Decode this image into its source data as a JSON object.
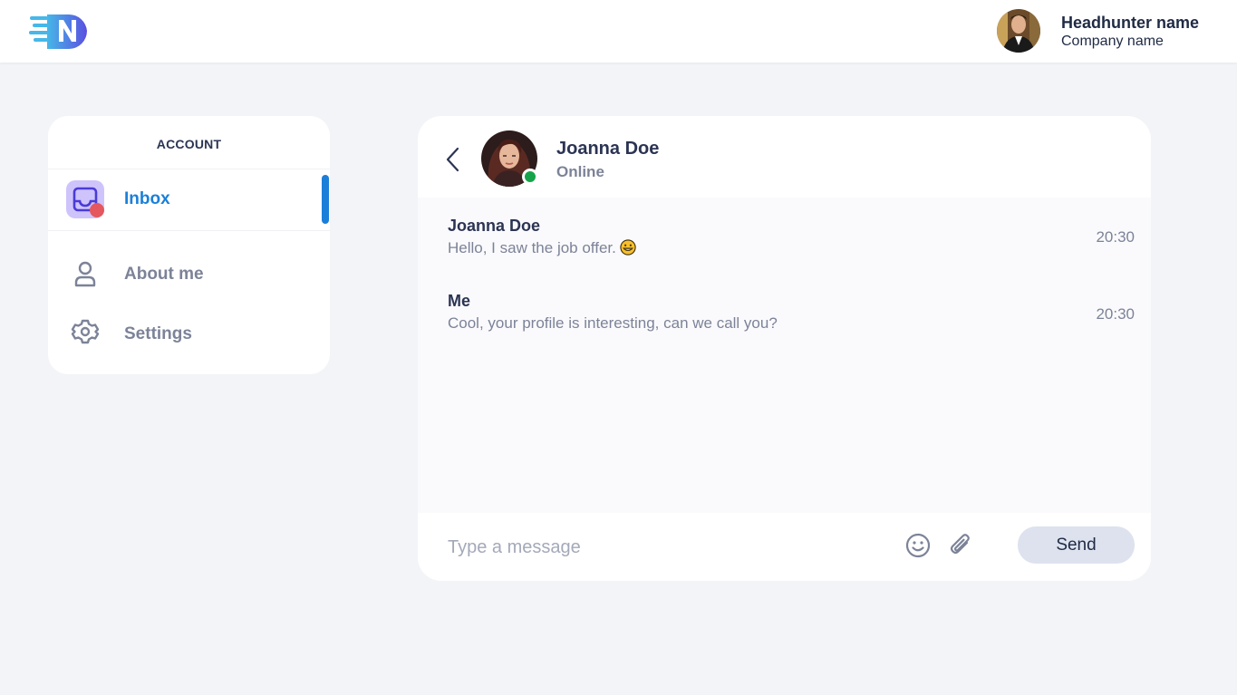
{
  "header": {
    "logo_icon": "n-speed-logo-icon",
    "user": {
      "avatar_icon": "headhunter-avatar",
      "name": "Headhunter name",
      "company": "Company name"
    }
  },
  "sidebar": {
    "heading": "ACCOUNT",
    "items": [
      {
        "label": "Inbox",
        "icon": "inbox-icon",
        "active": true,
        "badge": "notification-dot"
      },
      {
        "label": "About me",
        "icon": "user-icon",
        "active": false
      },
      {
        "label": "Settings",
        "icon": "gear-icon",
        "active": false
      }
    ]
  },
  "chat": {
    "contact": {
      "name": "Joanna Doe",
      "status": "Online",
      "avatar_icon": "contact-avatar"
    },
    "messages": [
      {
        "sender": "Joanna Doe",
        "text": "Hello, I saw the job offer.",
        "emoji": "grinning-face-emoji",
        "time": "20:30"
      },
      {
        "sender": "Me",
        "text": "Cool, your profile is interesting, can we call you?",
        "time": "20:30"
      }
    ],
    "composer": {
      "placeholder": "Type a message",
      "value": "",
      "send_label": "Send"
    }
  },
  "colors": {
    "accent": "#1b7fd9",
    "background": "#f3f4f8",
    "online": "#17a34a",
    "badge": "#e4575f",
    "inbox_icon_bg": "#cec4fb"
  }
}
